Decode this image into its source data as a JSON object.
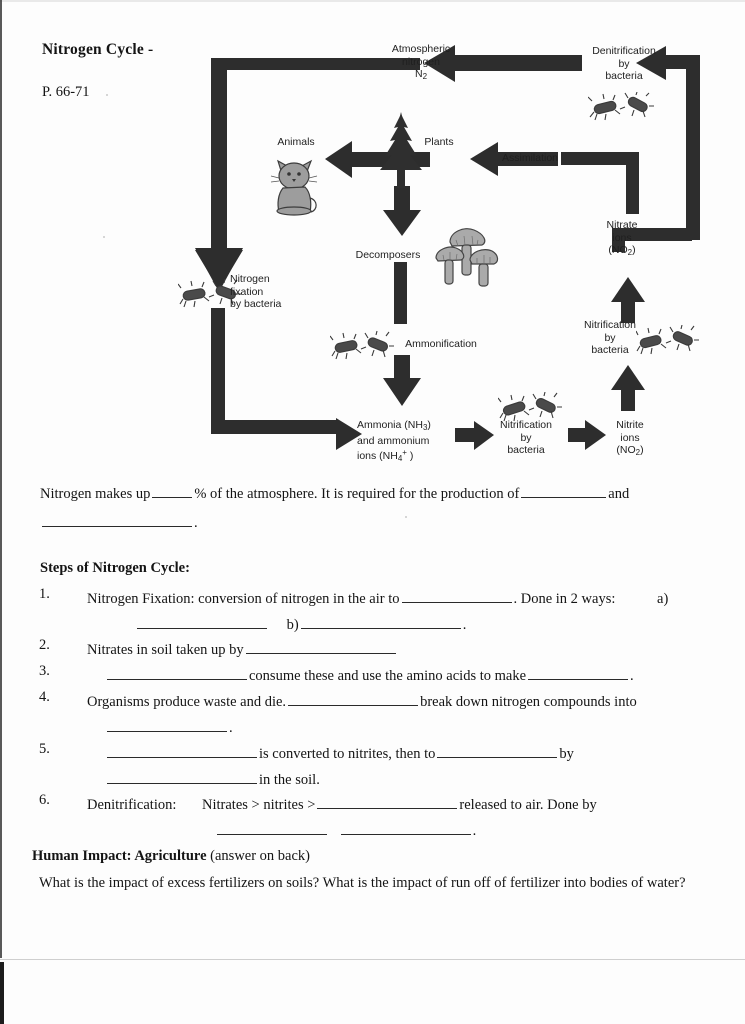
{
  "header": {
    "title": "Nitrogen Cycle -",
    "page_reference": "P. 66-71"
  },
  "diagram": {
    "name": "nitrogen-cycle-diagram",
    "labels": {
      "atmospheric_nitrogen": "Atmospheric\nnitrogen\nN2",
      "denitrification": "Denitrification\nby\nbacteria",
      "animals": "Animals",
      "plants": "Plants",
      "assimilation": "Assimilation",
      "nitrate_ions": "Nitrate\nions\n(NO2)",
      "decomposers": "Decomposers",
      "nitrogen_fixation": "Nitrogen\nfixation\nby bacteria",
      "ammonification": "Ammonification",
      "nitrification_right": "Nitrification\nby\nbacteria",
      "ammonia_line1": "Ammonia (NH3)",
      "ammonia_line2": "and ammonium",
      "ammonia_line3": "ions (NH4+ )",
      "nitrification_bottom": "Nitrification\nby\nbacteria",
      "nitrite_ions": "Nitrite\nions\n(NO2)"
    },
    "ink_color": "#2b2b2b"
  },
  "intro": {
    "line1_a": "Nitrogen makes up",
    "line1_b": "% of the atmosphere.  It is required for the production of",
    "line1_c": "and",
    "line2_end": "."
  },
  "steps_section": {
    "heading": "Steps of Nitrogen Cycle:",
    "steps": [
      {
        "number": "1.",
        "text_a": "Nitrogen Fixation: conversion of nitrogen in the air to",
        "text_b": ".  Done in 2 ways:",
        "text_c": "a)",
        "text_d": "b)",
        "text_e": "."
      },
      {
        "number": "2.",
        "text_a": "Nitrates in soil taken up by"
      },
      {
        "number": "3.",
        "text_a": "consume these and use the amino acids to make",
        "text_b": "."
      },
      {
        "number": "4.",
        "text_a": "Organisms produce waste and die.",
        "text_b": "break down nitrogen compounds into",
        "text_c": "."
      },
      {
        "number": "5.",
        "text_a": "is converted to nitrites, then to",
        "text_b": "by",
        "text_c": "in the soil."
      },
      {
        "number": "6.",
        "text_a": "Denitrification:",
        "text_b": "Nitrates > nitrites >",
        "text_c": "released to air.  Done by",
        "text_d": "."
      }
    ]
  },
  "human_impact": {
    "heading_bold": "Human Impact: Agriculture",
    "heading_note": "(answer on back)",
    "question": "What is the impact of excess fertilizers on soils?  What is the impact of run off of fertilizer into bodies of water?"
  }
}
